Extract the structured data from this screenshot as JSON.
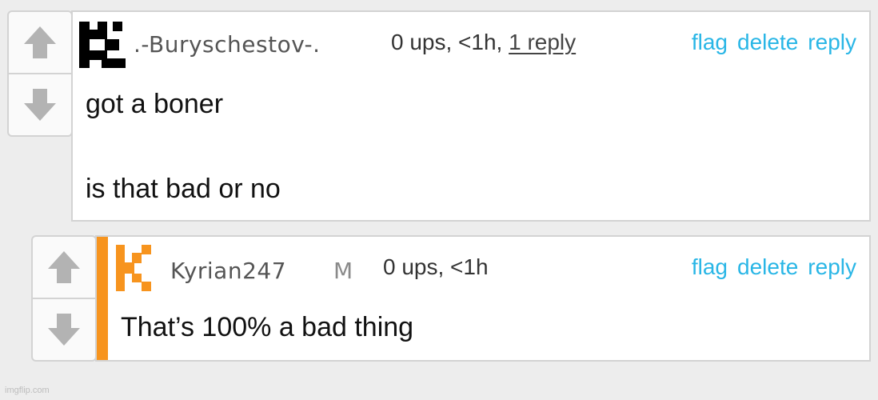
{
  "comments": [
    {
      "username": ".-Buryschestov-.",
      "meta_prefix": "0 ups, <1h, ",
      "reply_count_label": "1 reply",
      "lines": [
        "got a boner",
        "is that bad or no"
      ],
      "avatar_color": "#000000"
    },
    {
      "username": "Kyrian247",
      "mod_badge": "M",
      "meta": "0 ups, <1h",
      "lines": [
        "That’s 100% a bad thing"
      ],
      "avatar_color": "#f7941e",
      "stripe_color": "#f7941e"
    }
  ],
  "actions": {
    "flag": "flag",
    "delete": "delete",
    "reply": "reply"
  },
  "colors": {
    "link": "#29b6e6",
    "background": "#ededed",
    "arrow": "#b3b3b3"
  },
  "watermark": "imgflip.com"
}
